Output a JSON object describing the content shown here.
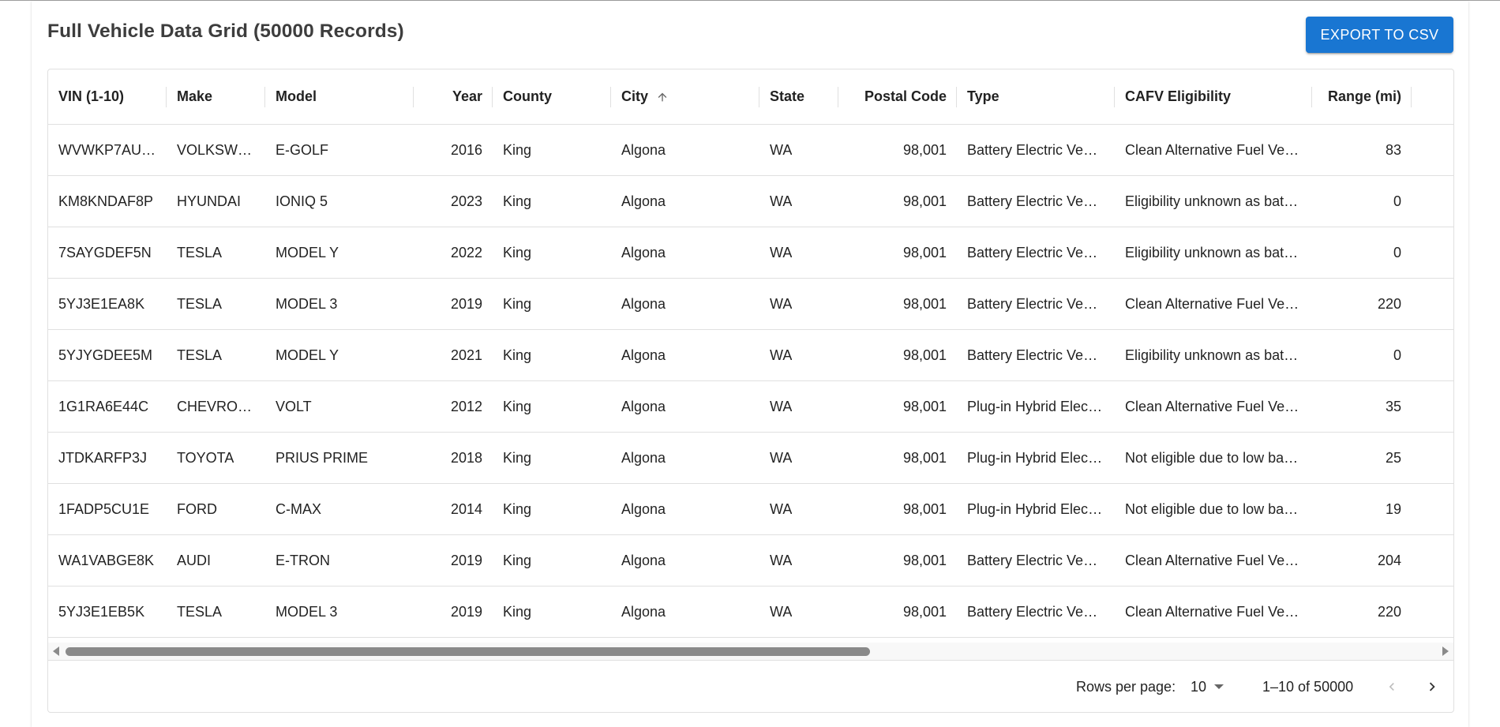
{
  "page": {
    "title": "Full Vehicle Data Grid (50000 Records)",
    "export_label": "EXPORT TO CSV"
  },
  "colors": {
    "primary": "#1976d2",
    "border": "#e0e0e0",
    "scrollbar": "#8a8a8a"
  },
  "grid": {
    "columns": [
      {
        "key": "vin",
        "label": "VIN (1-10)"
      },
      {
        "key": "make",
        "label": "Make"
      },
      {
        "key": "model",
        "label": "Model"
      },
      {
        "key": "year",
        "label": "Year"
      },
      {
        "key": "county",
        "label": "County"
      },
      {
        "key": "city",
        "label": "City",
        "sorted": "ascending"
      },
      {
        "key": "state",
        "label": "State"
      },
      {
        "key": "postal",
        "label": "Postal Code"
      },
      {
        "key": "type",
        "label": "Type"
      },
      {
        "key": "cafv",
        "label": "CAFV Eligibility"
      },
      {
        "key": "range",
        "label": "Range (mi)"
      }
    ],
    "rows": [
      [
        "WVWKP7AU…",
        "VOLKSW…",
        "E-GOLF",
        "2016",
        "King",
        "Algona",
        "WA",
        "98,001",
        "Battery Electric Vehi…",
        "Clean Alternative Fuel Veh…",
        "83"
      ],
      [
        "KM8KNDAF8P",
        "HYUNDAI",
        "IONIQ 5",
        "2023",
        "King",
        "Algona",
        "WA",
        "98,001",
        "Battery Electric Vehi…",
        "Eligibility unknown as batt…",
        "0"
      ],
      [
        "7SAYGDEF5N",
        "TESLA",
        "MODEL Y",
        "2022",
        "King",
        "Algona",
        "WA",
        "98,001",
        "Battery Electric Vehi…",
        "Eligibility unknown as batt…",
        "0"
      ],
      [
        "5YJ3E1EA8K",
        "TESLA",
        "MODEL 3",
        "2019",
        "King",
        "Algona",
        "WA",
        "98,001",
        "Battery Electric Vehi…",
        "Clean Alternative Fuel Veh…",
        "220"
      ],
      [
        "5YJYGDEE5M",
        "TESLA",
        "MODEL Y",
        "2021",
        "King",
        "Algona",
        "WA",
        "98,001",
        "Battery Electric Vehi…",
        "Eligibility unknown as batt…",
        "0"
      ],
      [
        "1G1RA6E44C",
        "CHEVRO…",
        "VOLT",
        "2012",
        "King",
        "Algona",
        "WA",
        "98,001",
        "Plug-in Hybrid Elect…",
        "Clean Alternative Fuel Veh…",
        "35"
      ],
      [
        "JTDKARFP3J",
        "TOYOTA",
        "PRIUS PRIME",
        "2018",
        "King",
        "Algona",
        "WA",
        "98,001",
        "Plug-in Hybrid Elect…",
        "Not eligible due to low batt…",
        "25"
      ],
      [
        "1FADP5CU1E",
        "FORD",
        "C-MAX",
        "2014",
        "King",
        "Algona",
        "WA",
        "98,001",
        "Plug-in Hybrid Elect…",
        "Not eligible due to low batt…",
        "19"
      ],
      [
        "WA1VABGE8K",
        "AUDI",
        "E-TRON",
        "2019",
        "King",
        "Algona",
        "WA",
        "98,001",
        "Battery Electric Vehi…",
        "Clean Alternative Fuel Veh…",
        "204"
      ],
      [
        "5YJ3E1EB5K",
        "TESLA",
        "MODEL 3",
        "2019",
        "King",
        "Algona",
        "WA",
        "98,001",
        "Battery Electric Vehi…",
        "Clean Alternative Fuel Veh…",
        "220"
      ]
    ]
  },
  "pagination": {
    "rows_per_page_label": "Rows per page:",
    "rows_per_page_value": "10",
    "range_text": "1–10 of 50000"
  },
  "icons": {
    "sort": "arrow-up-icon",
    "dropdown": "caret-down-icon",
    "prev": "chevron-left-icon",
    "next": "chevron-right-icon"
  }
}
